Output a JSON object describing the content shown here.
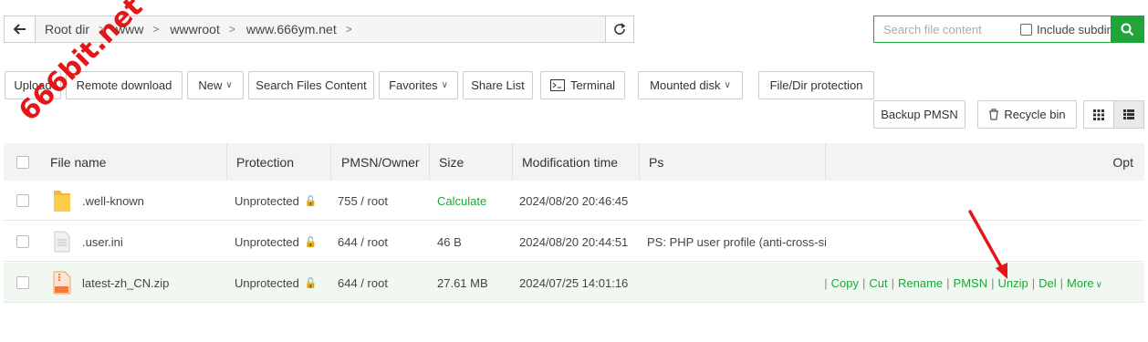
{
  "path": {
    "crumbs": [
      "Root dir",
      "www",
      "wwwroot",
      "www.666ym.net"
    ]
  },
  "search": {
    "placeholder": "Search file content",
    "include_subdir": "Include subdir"
  },
  "toolbar": {
    "upload": "Upload",
    "remote_download": "Remote download",
    "new": "New",
    "search_files": "Search Files Content",
    "favorites": "Favorites",
    "share_list": "Share List",
    "terminal": "Terminal",
    "mounted_disk": "Mounted disk",
    "protection": "File/Dir protection",
    "backup_pmsn": "Backup PMSN",
    "recycle_bin": "Recycle bin"
  },
  "table": {
    "headers": {
      "name": "File name",
      "protection": "Protection",
      "pmsn": "PMSN/Owner",
      "size": "Size",
      "mtime": "Modification time",
      "ps": "Ps",
      "opt": "Opt"
    },
    "rows": [
      {
        "name": ".well-known",
        "protection": "Unprotected",
        "pmsn": "755 / root",
        "size": "Calculate",
        "mtime": "2024/08/20 20:46:45",
        "ps": ""
      },
      {
        "name": ".user.ini",
        "protection": "Unprotected",
        "pmsn": "644 / root",
        "size": "46 B",
        "mtime": "2024/08/20 20:44:51",
        "ps": "PS: PHP user profile (anti-cross-sit"
      },
      {
        "name": "latest-zh_CN.zip",
        "protection": "Unprotected",
        "pmsn": "644 / root",
        "size": "27.61 MB",
        "mtime": "2024/07/25 14:01:16",
        "ps": ""
      }
    ],
    "ops": [
      "Copy",
      "Cut",
      "Rename",
      "PMSN",
      "Unzip",
      "Del",
      "More"
    ]
  },
  "watermark": "666bit.net",
  "colors": {
    "accent": "#20a53a",
    "arrow": "#e5161a"
  }
}
